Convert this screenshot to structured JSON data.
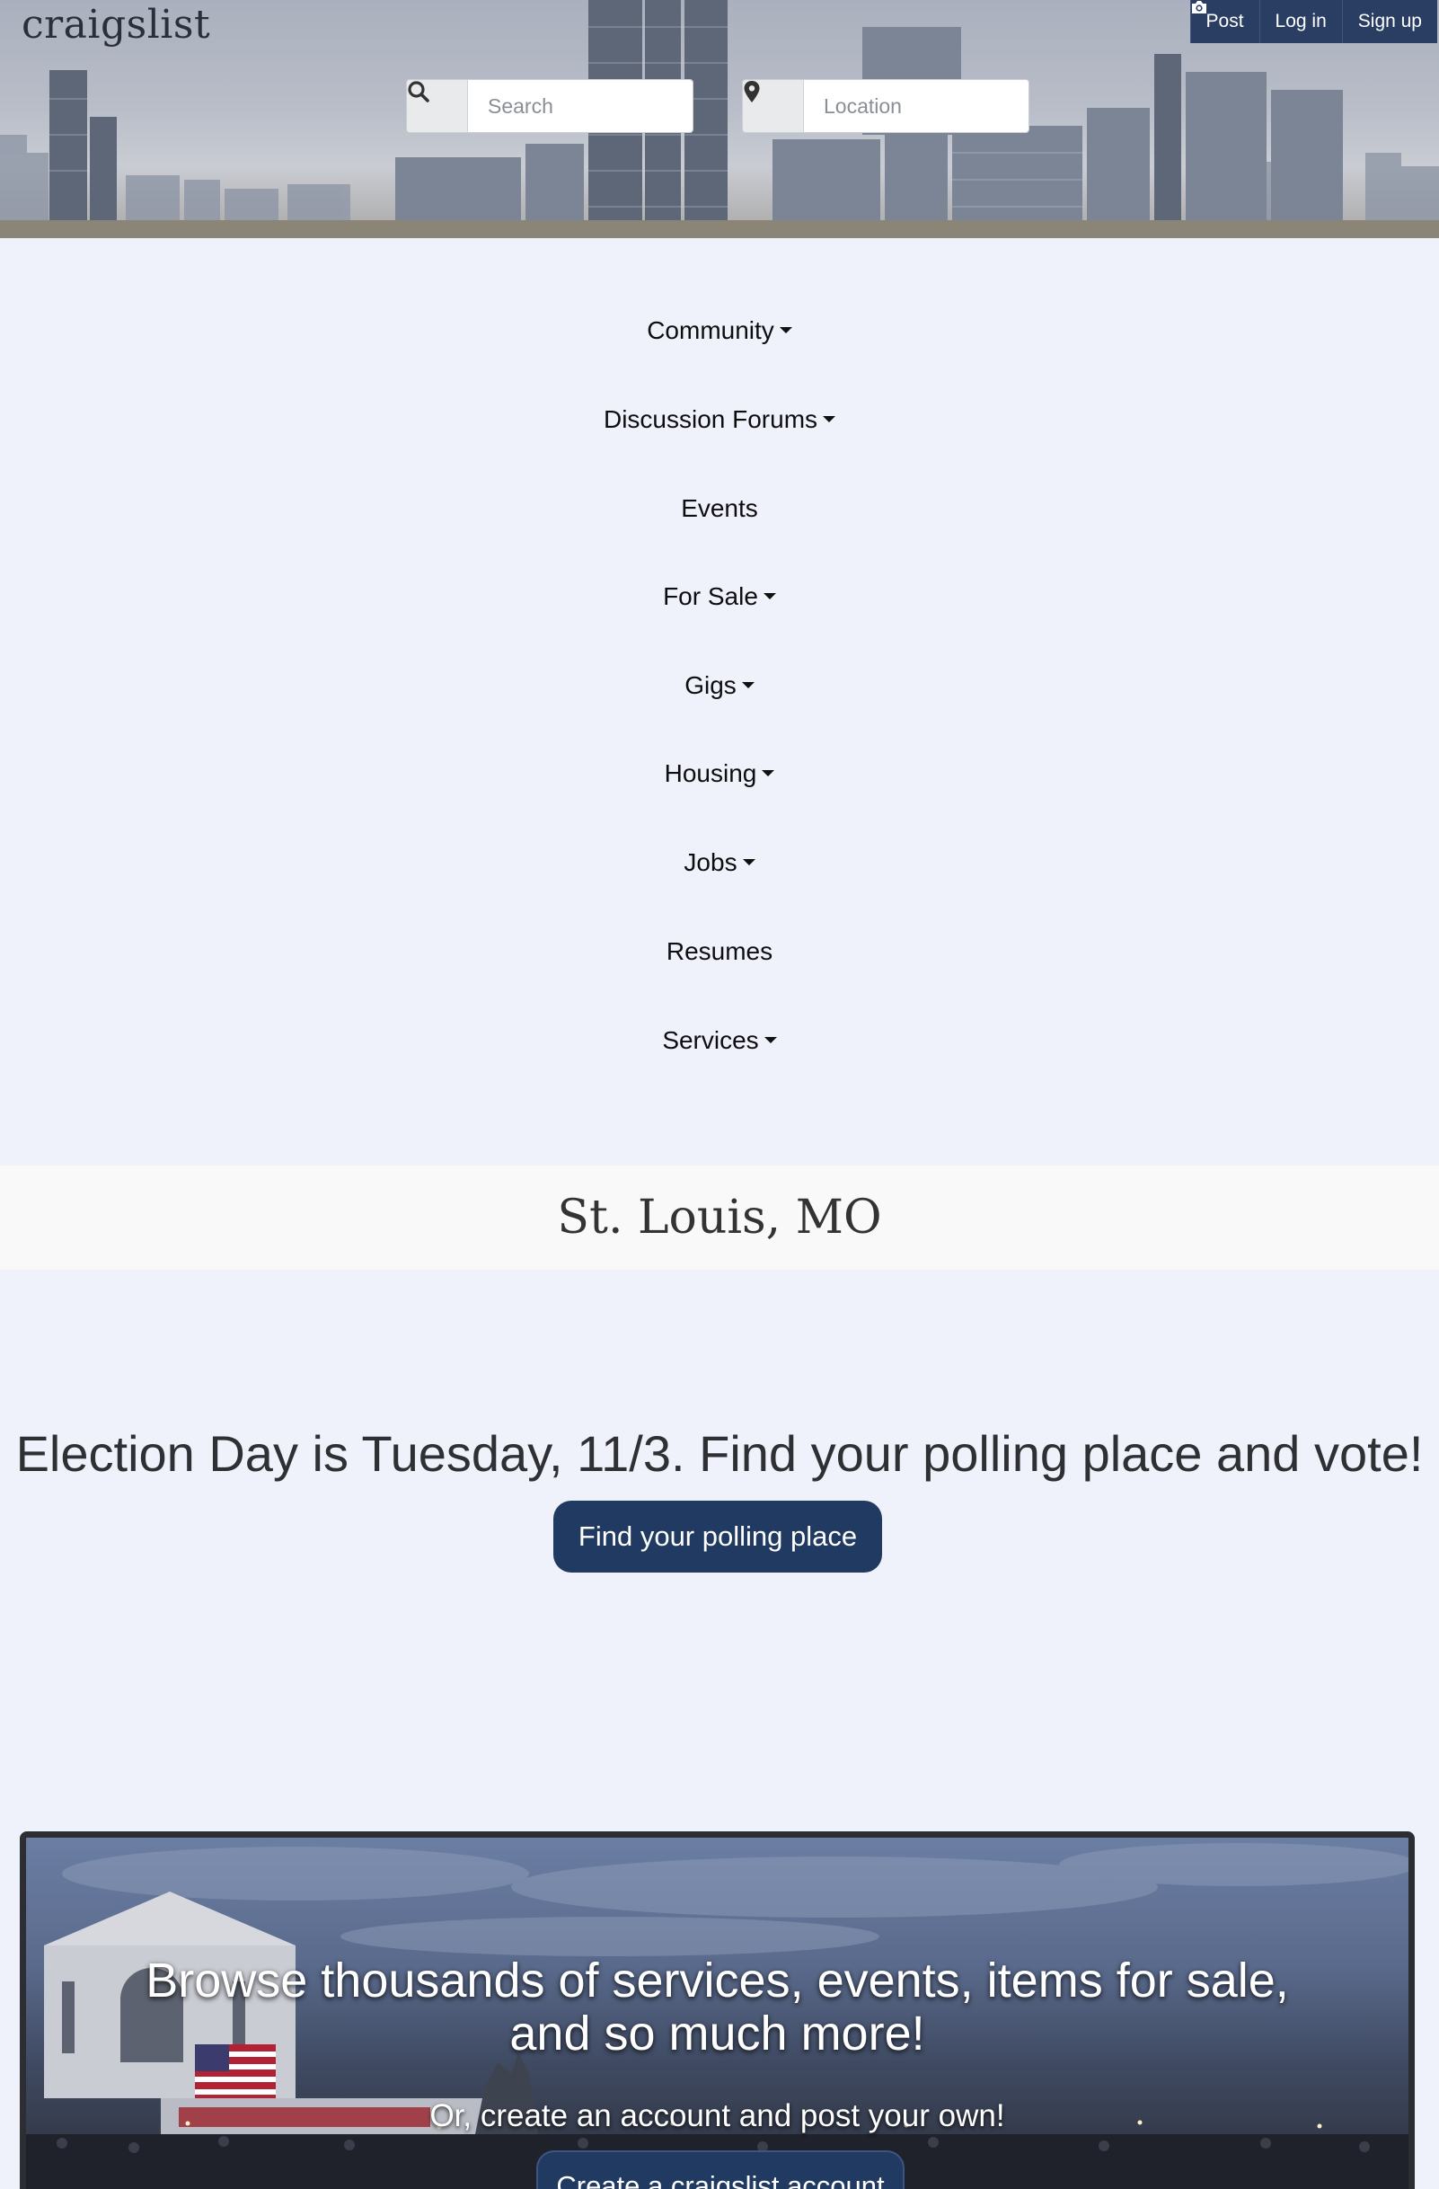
{
  "header": {
    "logo": "craigslist",
    "nav": {
      "post_label": "Post",
      "login_label": "Log in",
      "signup_label": "Sign up"
    },
    "search": {
      "placeholder": "Search",
      "value": ""
    },
    "location": {
      "placeholder": "Location",
      "value": ""
    }
  },
  "categories": [
    {
      "label": "Community",
      "dropdown": true
    },
    {
      "label": "Discussion Forums",
      "dropdown": true
    },
    {
      "label": "Events",
      "dropdown": false
    },
    {
      "label": "For Sale",
      "dropdown": true
    },
    {
      "label": "Gigs",
      "dropdown": true
    },
    {
      "label": "Housing",
      "dropdown": true
    },
    {
      "label": "Jobs",
      "dropdown": true
    },
    {
      "label": "Resumes",
      "dropdown": false
    },
    {
      "label": "Services",
      "dropdown": true
    }
  ],
  "city": "St. Louis, MO",
  "election": {
    "message": "Election Day is Tuesday, 11/3. Find your polling place and vote!",
    "button_label": "Find your polling place"
  },
  "promo": {
    "title": "Browse thousands of services, events, items for sale, and so much more!",
    "subtitle": "Or, create an account and post your own!",
    "button_label": "Create a craigslist account"
  },
  "colors": {
    "accent": "#213a61",
    "background": "#eff1fb",
    "city_band": "#f9f9fa"
  }
}
